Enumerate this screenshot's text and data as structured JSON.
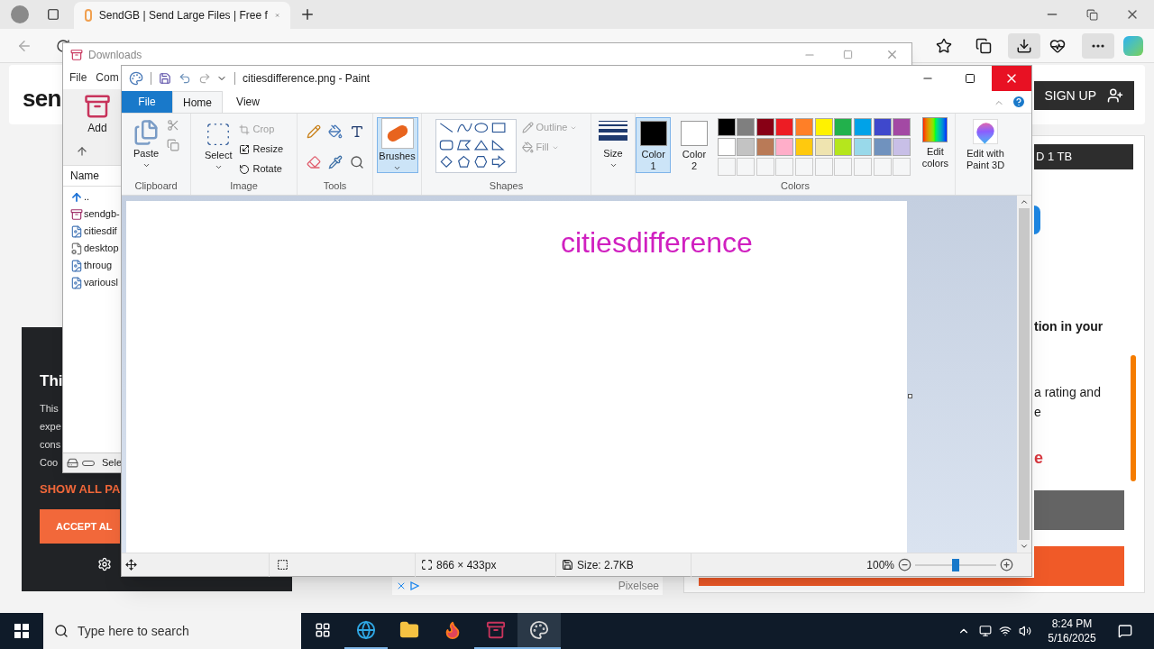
{
  "browser": {
    "tab": {
      "title": "SendGB | Send Large Files | Free f"
    }
  },
  "page": {
    "logo": "sen",
    "signup": "SIGN UP",
    "plan_bar": "D 1 TB",
    "heading_fragment": "tion in your",
    "text_fragment_1": "a rating and",
    "text_fragment_2": "e",
    "link_fragment": "e"
  },
  "cookie_banner": {
    "title": "Thi",
    "lines": [
      "This",
      "expe",
      "cons",
      "Coo"
    ],
    "show_all": "SHOW ALL PA",
    "accept": "ACCEPT AL"
  },
  "ad": {
    "label": "Pixelsee"
  },
  "downloads_window": {
    "title": "Downloads",
    "menu": [
      "File",
      "Com"
    ],
    "add": "Add",
    "column": "Name",
    "status": "Sele",
    "files": [
      {
        "name": "..",
        "kind": "up"
      },
      {
        "name": "sendgb-",
        "kind": "archive"
      },
      {
        "name": "citiesdif",
        "kind": "image"
      },
      {
        "name": "desktop",
        "kind": "settings"
      },
      {
        "name": "throug",
        "kind": "image"
      },
      {
        "name": "variousl",
        "kind": "image"
      }
    ]
  },
  "paint": {
    "title": "citiesdifference.png - Paint",
    "tabs": [
      {
        "label": "File",
        "kind": "menu",
        "selected": false
      },
      {
        "label": "Home",
        "kind": "tab",
        "selected": true
      },
      {
        "label": "View",
        "kind": "tab",
        "selected": false
      }
    ],
    "groups": {
      "clipboard": "Clipboard",
      "image": "Image",
      "tools": "Tools",
      "shapes": "Shapes",
      "colors": "Colors"
    },
    "paste": "Paste",
    "select": "Select",
    "image_tools": [
      {
        "label": "Crop",
        "disabled": true
      },
      {
        "label": "Resize",
        "disabled": false
      },
      {
        "label": "Rotate",
        "disabled": false
      }
    ],
    "brushes": {
      "label": "Brushes",
      "selected": true
    },
    "shape_options": [
      {
        "label": "Outline",
        "disabled": true
      },
      {
        "label": "Fill",
        "disabled": true
      }
    ],
    "size": "Size",
    "color_slots": [
      {
        "label": "Color",
        "number": "1",
        "color": "#000000",
        "selected": true
      },
      {
        "label": "Color",
        "number": "2",
        "color": "#ffffff",
        "selected": false
      }
    ],
    "palette": [
      {
        "color": "#000000"
      },
      {
        "color": "#7f7f7f"
      },
      {
        "color": "#880015"
      },
      {
        "color": "#ed1c24"
      },
      {
        "color": "#ff7f27"
      },
      {
        "color": "#fff200"
      },
      {
        "color": "#22b14c"
      },
      {
        "color": "#00a2e8"
      },
      {
        "color": "#3f48cc"
      },
      {
        "color": "#a349a4"
      },
      {
        "color": "#ffffff"
      },
      {
        "color": "#c3c3c3"
      },
      {
        "color": "#b97a57"
      },
      {
        "color": "#ffaec9"
      },
      {
        "color": "#ffc90e"
      },
      {
        "color": "#efe4b0"
      },
      {
        "color": "#b5e61d"
      },
      {
        "color": "#99d9ea"
      },
      {
        "color": "#7092be"
      },
      {
        "color": "#c8bfe7"
      }
    ],
    "edit_colors": "Edit colors",
    "paint3d": "Edit with Paint 3D",
    "canvas_text": "citiesdifference",
    "status": {
      "dimensions": "866 × 433px",
      "size": "Size: 2.7KB",
      "zoom": "100%",
      "level": 0.5
    }
  },
  "taskbar": {
    "search": "Type here to search",
    "time": "8:24 PM",
    "date": "5/16/2025",
    "apps": [
      {
        "kind": "tasks",
        "running": false,
        "selected": false
      },
      {
        "kind": "edge",
        "running": true,
        "selected": false
      },
      {
        "kind": "folder",
        "running": false,
        "selected": false
      },
      {
        "kind": "firefox",
        "running": false,
        "selected": false
      },
      {
        "kind": "archive",
        "running": true,
        "selected": false
      },
      {
        "kind": "paint",
        "running": true,
        "selected": true
      }
    ]
  }
}
